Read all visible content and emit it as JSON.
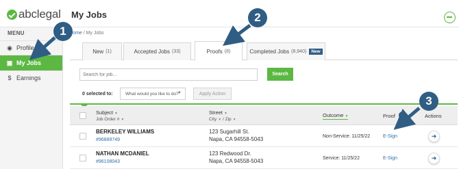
{
  "header": {
    "logo_text": "abclegal",
    "page_title": "My Jobs"
  },
  "sidebar": {
    "menu_label": "MENU",
    "items": [
      {
        "label": "Profile",
        "icon": "user-circle-icon",
        "glyph": "◉"
      },
      {
        "label": "My Jobs",
        "icon": "briefcase-icon",
        "glyph": "▣"
      },
      {
        "label": "Earnings",
        "icon": "dollar-icon",
        "glyph": "$"
      }
    ]
  },
  "breadcrumb": {
    "home": "Home",
    "sep": "/",
    "current": "My Jobs"
  },
  "tabs": [
    {
      "label": "New",
      "count": "(1)"
    },
    {
      "label": "Accepted Jobs",
      "count": "(33)"
    },
    {
      "label": "Proofs",
      "count": "(8)"
    },
    {
      "label": "Completed Jobs",
      "count": "(8,940)",
      "badge": "New"
    }
  ],
  "search": {
    "placeholder": "Search for job...",
    "button_label": "Search"
  },
  "bulk": {
    "selected_label": "0 selected to:",
    "action_placeholder": "What would you like to do?",
    "apply_label": "Apply Action"
  },
  "table": {
    "headers": {
      "subject": "Subject",
      "job_order": "Job Order #",
      "street": "Street",
      "city": "City",
      "city_zip_sep": "/",
      "zip": "Zip",
      "outcome": "Outcome",
      "proof": "Proof",
      "actions": "Actions"
    },
    "rows": [
      {
        "name": "BERKELEY WILLIAMS",
        "order": "#96889749",
        "street": "123 Sugarhill St.",
        "city_zip": "Napa, CA 94558-5043",
        "outcome": "Non-Service: 11/25/22",
        "proof": "E-Sign"
      },
      {
        "name": "NATHAN MCDANIEL",
        "order": "#96108043",
        "street": "123 Redwood Dr.",
        "city_zip": "Napa, CA 94558-5043",
        "outcome": "Service: 11/25/22",
        "proof": "E-Sign"
      }
    ]
  },
  "callouts": [
    "1",
    "2",
    "3"
  ],
  "colors": {
    "brand_green": "#5cb843",
    "callout_blue": "#2f5d84",
    "link_blue": "#2f6fa7"
  }
}
